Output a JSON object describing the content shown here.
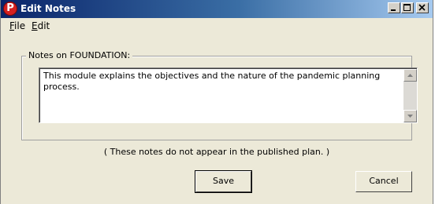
{
  "window": {
    "title": "Edit Notes",
    "app_icon_letter": "P",
    "app_icon_color": "#d42020",
    "titlebar_color": "#0a246a"
  },
  "menu": {
    "items": [
      {
        "label": "File",
        "accel": "F"
      },
      {
        "label": "Edit",
        "accel": "E"
      }
    ]
  },
  "notes": {
    "group_label": "Notes on FOUNDATION:",
    "text": "This module explains the objectives and the nature of the pandemic planning process."
  },
  "footer_note": "( These notes do not appear in the published plan. )",
  "buttons": {
    "save_label": "Save",
    "cancel_label": "Cancel"
  }
}
